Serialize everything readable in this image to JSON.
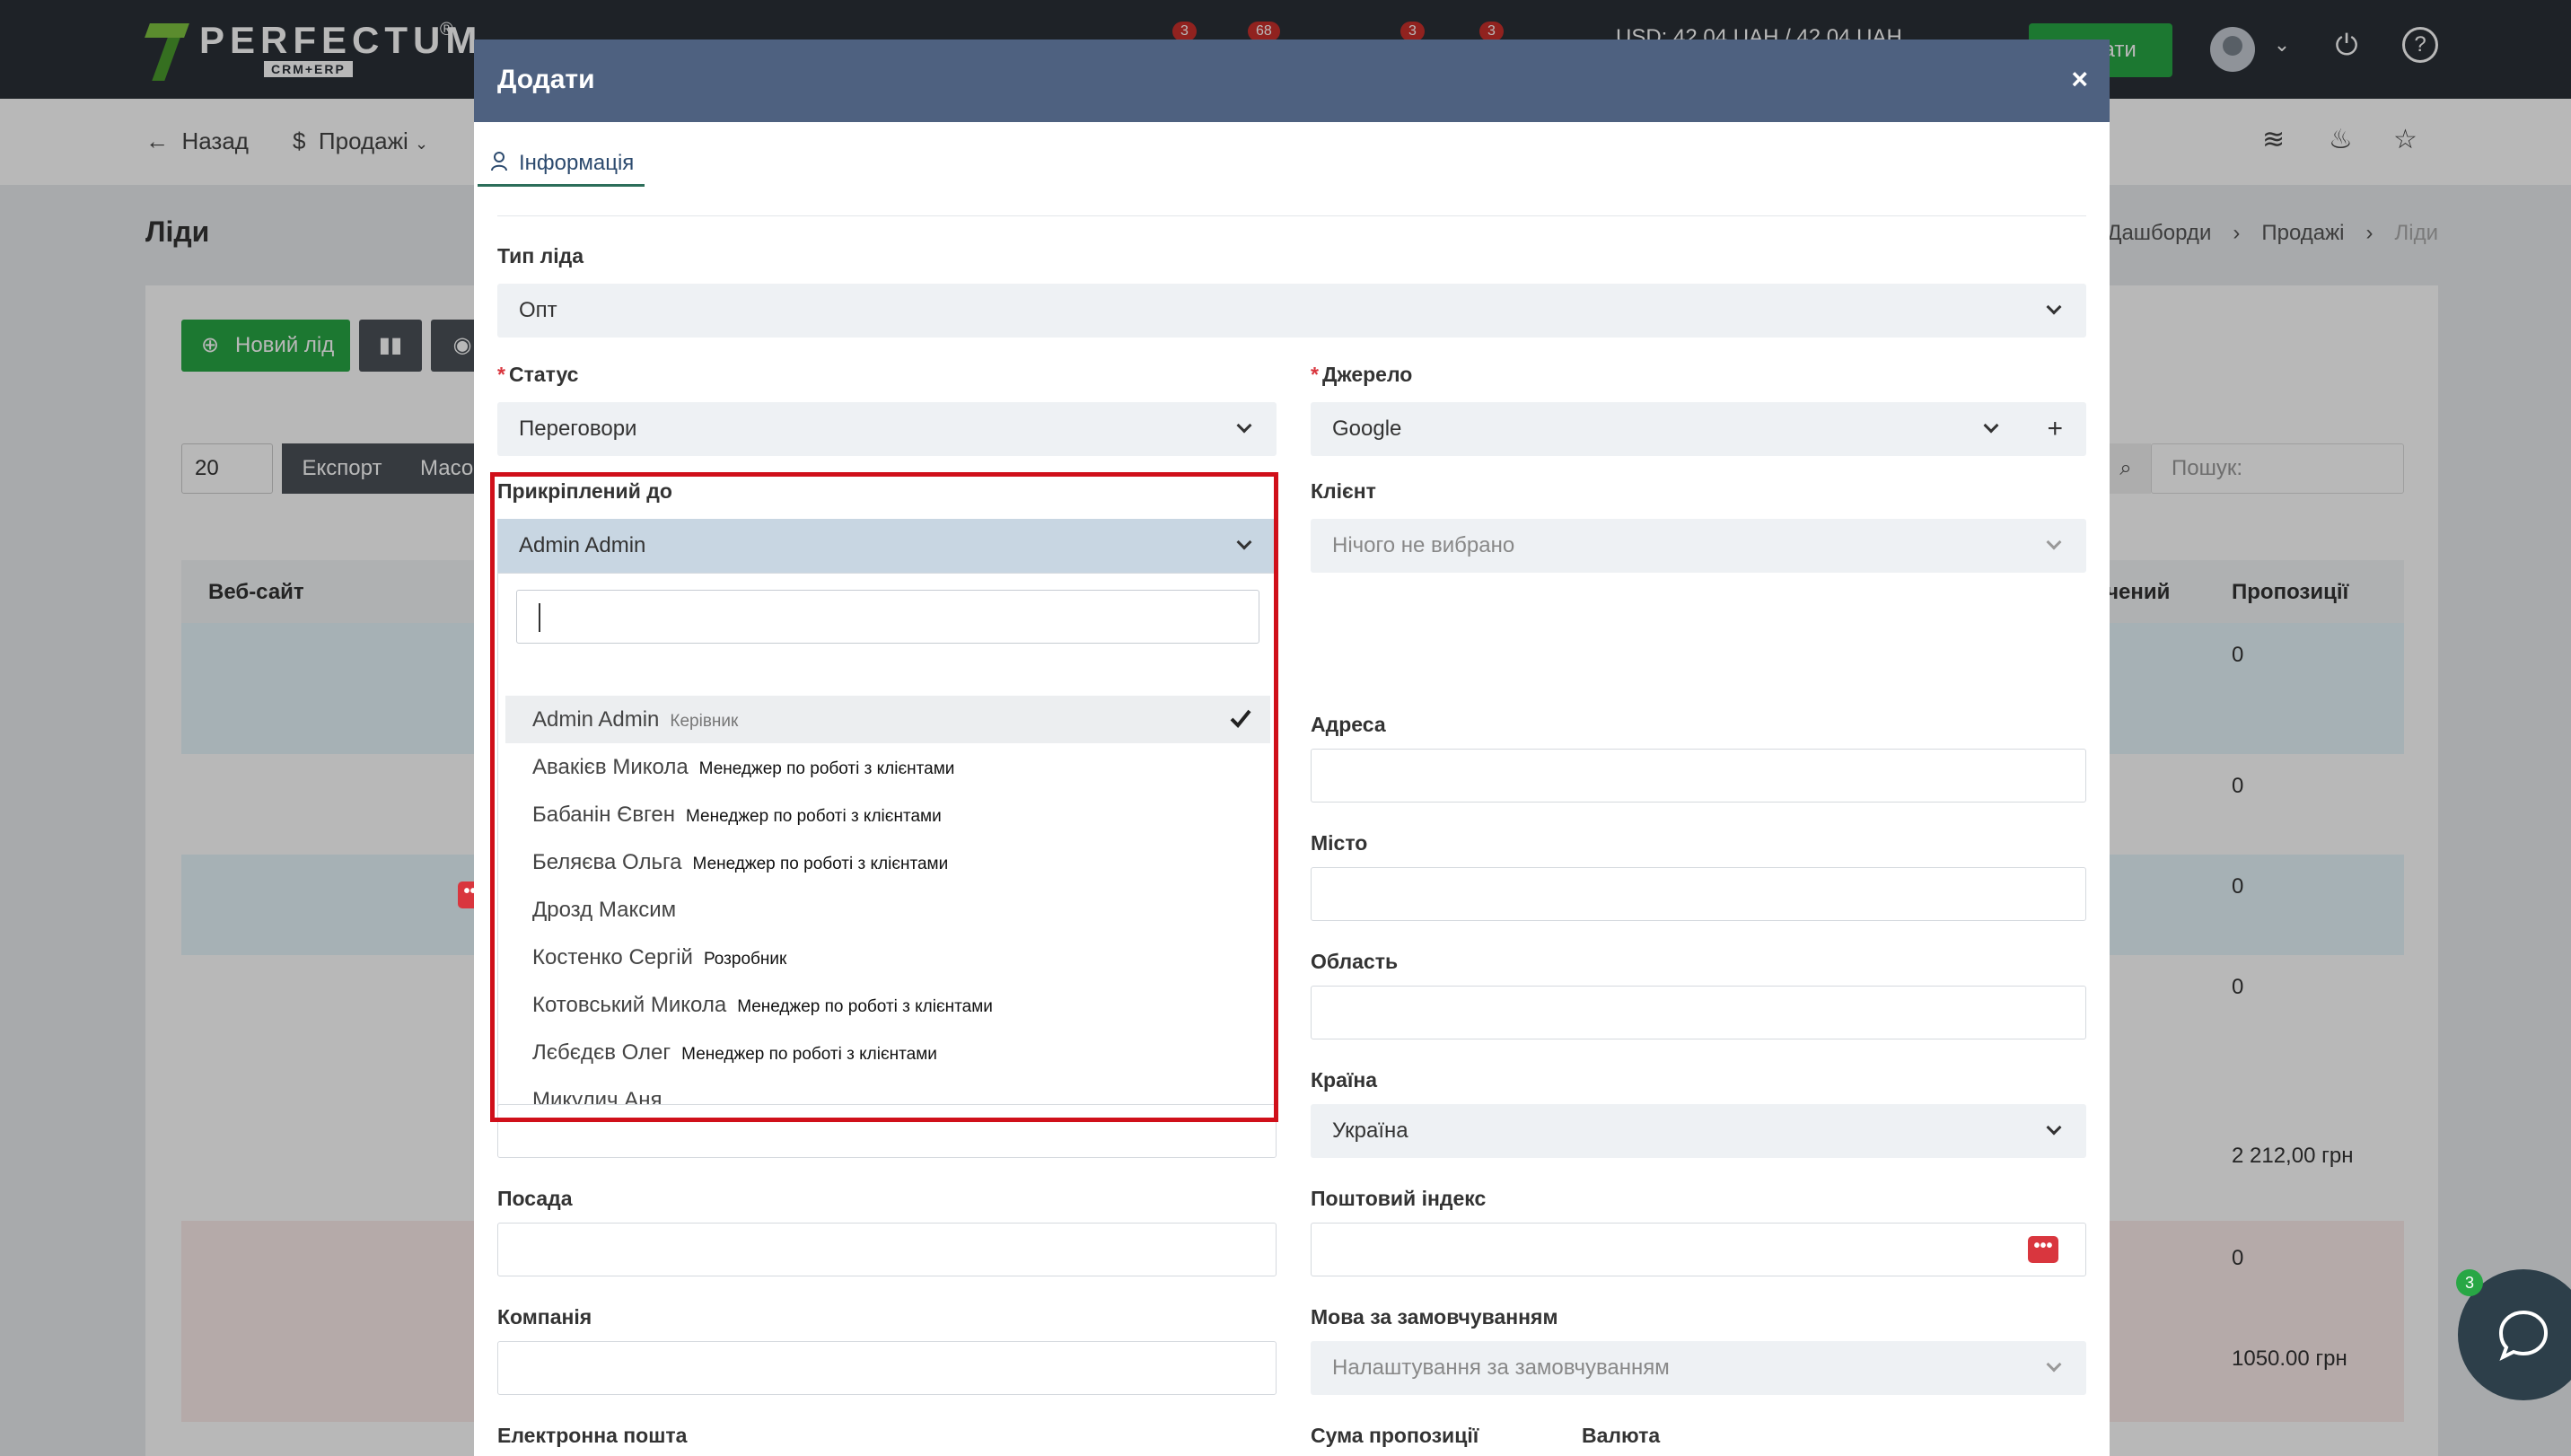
{
  "topbar": {
    "logo_text": "PERFECTUM",
    "logo_sub": "CRM+ERP",
    "logo_reg": "®",
    "badges": [
      "3",
      "68",
      "3",
      "3"
    ],
    "currency_text": "USD: 42.04 UAH / 42.04 UAH",
    "green_button_label": "чати",
    "user_menu_chevron": "⌄",
    "power_icon": "⏻",
    "help_icon": "?"
  },
  "subbar": {
    "back_label": "Назад",
    "sales_label": "Продажі"
  },
  "page": {
    "title": "Ліди",
    "breadcrumbs": [
      "Дашборди",
      "Продажі",
      "Ліди"
    ],
    "breadcrumb_sep": "›",
    "new_lead_label": "Новий лід",
    "per_page": "20",
    "export_label": "Експорт",
    "mass_label": "Масо",
    "search_placeholder": "Пошук:",
    "table_headers": {
      "website": "Веб-сайт",
      "converted": "очений",
      "proposals": "Пропозиції"
    },
    "proposal_values": [
      "0",
      "0",
      "0",
      "0",
      "2 212,00 грн",
      "0",
      "1050.00 грн"
    ]
  },
  "chat": {
    "badge": "3"
  },
  "modal": {
    "title": "Додати",
    "close": "×",
    "tab_info": "Інформація",
    "lead_type": {
      "label": "Тип ліда",
      "value": "Опт"
    },
    "status": {
      "label": "Статус",
      "value": "Переговори",
      "required": "*"
    },
    "source": {
      "label": "Джерело",
      "value": "Google",
      "required": "*",
      "add": "+"
    },
    "assigned": {
      "label": "Прикріплений до",
      "value": "Admin Admin",
      "search_value": "",
      "options": [
        {
          "name": "Admin Admin",
          "role": "Керівник",
          "selected": true
        },
        {
          "name": "Авакієв Микола",
          "role": "Менеджер по роботі з клієнтами",
          "selected": false
        },
        {
          "name": "Бабанін Євген",
          "role": "Менеджер по роботі з клієнтами",
          "selected": false
        },
        {
          "name": "Беляєва Ольга",
          "role": "Менеджер по роботі з клієнтами",
          "selected": false
        },
        {
          "name": "Дрозд Максим",
          "role": "",
          "selected": false
        },
        {
          "name": "Костенко Сергій",
          "role": "Розробник",
          "selected": false
        },
        {
          "name": "Котовський Микола",
          "role": "Менеджер по роботі з клієнтами",
          "selected": false
        },
        {
          "name": "Лєбєдєв Олег",
          "role": "Менеджер по роботі з клієнтами",
          "selected": false
        },
        {
          "name": "Микулич Аня",
          "role": "",
          "selected": false
        }
      ]
    },
    "client": {
      "label": "Клієнт",
      "placeholder": "Нічого не вибрано"
    },
    "address": {
      "label": "Адреса"
    },
    "city": {
      "label": "Місто"
    },
    "region": {
      "label": "Область"
    },
    "country": {
      "label": "Країна",
      "value": "Україна"
    },
    "position": {
      "label": "Посада"
    },
    "postal": {
      "label": "Поштовий індекс"
    },
    "company": {
      "label": "Компанія"
    },
    "language": {
      "label": "Мова за замовчуванням",
      "value": "Налаштування за замовчуванням"
    },
    "email": {
      "label": "Електронна пошта"
    },
    "proposal_sum": {
      "label": "Сума пропозиції"
    },
    "currency": {
      "label": "Валюта"
    }
  },
  "colors": {
    "topbar": "#2a3037",
    "modal_header": "#4e6180",
    "green": "#28a745",
    "highlight": "#d0101a"
  }
}
